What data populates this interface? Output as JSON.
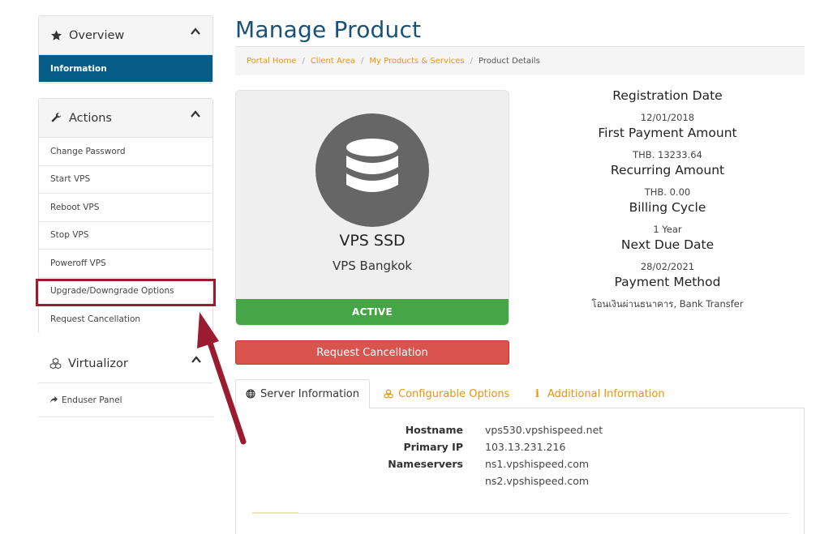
{
  "sidebar": {
    "overview": {
      "title": "Overview",
      "items": [
        {
          "label": "Information"
        }
      ]
    },
    "actions": {
      "title": "Actions",
      "items": [
        {
          "label": "Change Password"
        },
        {
          "label": "Start VPS"
        },
        {
          "label": "Reboot VPS"
        },
        {
          "label": "Stop VPS"
        },
        {
          "label": "Poweroff VPS"
        },
        {
          "label": "Upgrade/Downgrade Options"
        },
        {
          "label": "Request Cancellation"
        }
      ]
    },
    "virtualizor": {
      "title": "Virtualizor",
      "items": [
        {
          "label": "Enduser Panel"
        }
      ]
    }
  },
  "page": {
    "title": "Manage Product"
  },
  "breadcrumb": [
    {
      "label": "Portal Home"
    },
    {
      "label": "Client Area"
    },
    {
      "label": "My Products & Services"
    },
    {
      "label": "Product Details"
    }
  ],
  "product": {
    "name": "VPS SSD",
    "group": "VPS Bangkok",
    "status": "ACTIVE",
    "cancel_label": "Request Cancellation"
  },
  "details": [
    {
      "label": "Registration Date",
      "value": "12/01/2018"
    },
    {
      "label": "First Payment Amount",
      "value": "THB. 13233.64"
    },
    {
      "label": "Recurring Amount",
      "value": "THB. 0.00"
    },
    {
      "label": "Billing Cycle",
      "value": "1 Year"
    },
    {
      "label": "Next Due Date",
      "value": "28/02/2021"
    },
    {
      "label": "Payment Method",
      "value": "โอนเงินผ่านธนาคาร, Bank Transfer"
    }
  ],
  "tabs": [
    {
      "label": "Server Information"
    },
    {
      "label": "Configurable Options"
    },
    {
      "label": "Additional Information"
    }
  ],
  "server": {
    "hostname_label": "Hostname",
    "hostname": "vps530.vpshispeed.net",
    "ip_label": "Primary IP",
    "ip": "103.13.231.216",
    "ns_label": "Nameservers",
    "ns1": "ns1.vpshispeed.com",
    "ns2": "ns2.vpshispeed.com"
  },
  "colors": {
    "primary": "#055d87",
    "accent": "#e8960c",
    "active": "#46a546",
    "danger": "#d9534f",
    "annotation": "#9b1b30"
  }
}
